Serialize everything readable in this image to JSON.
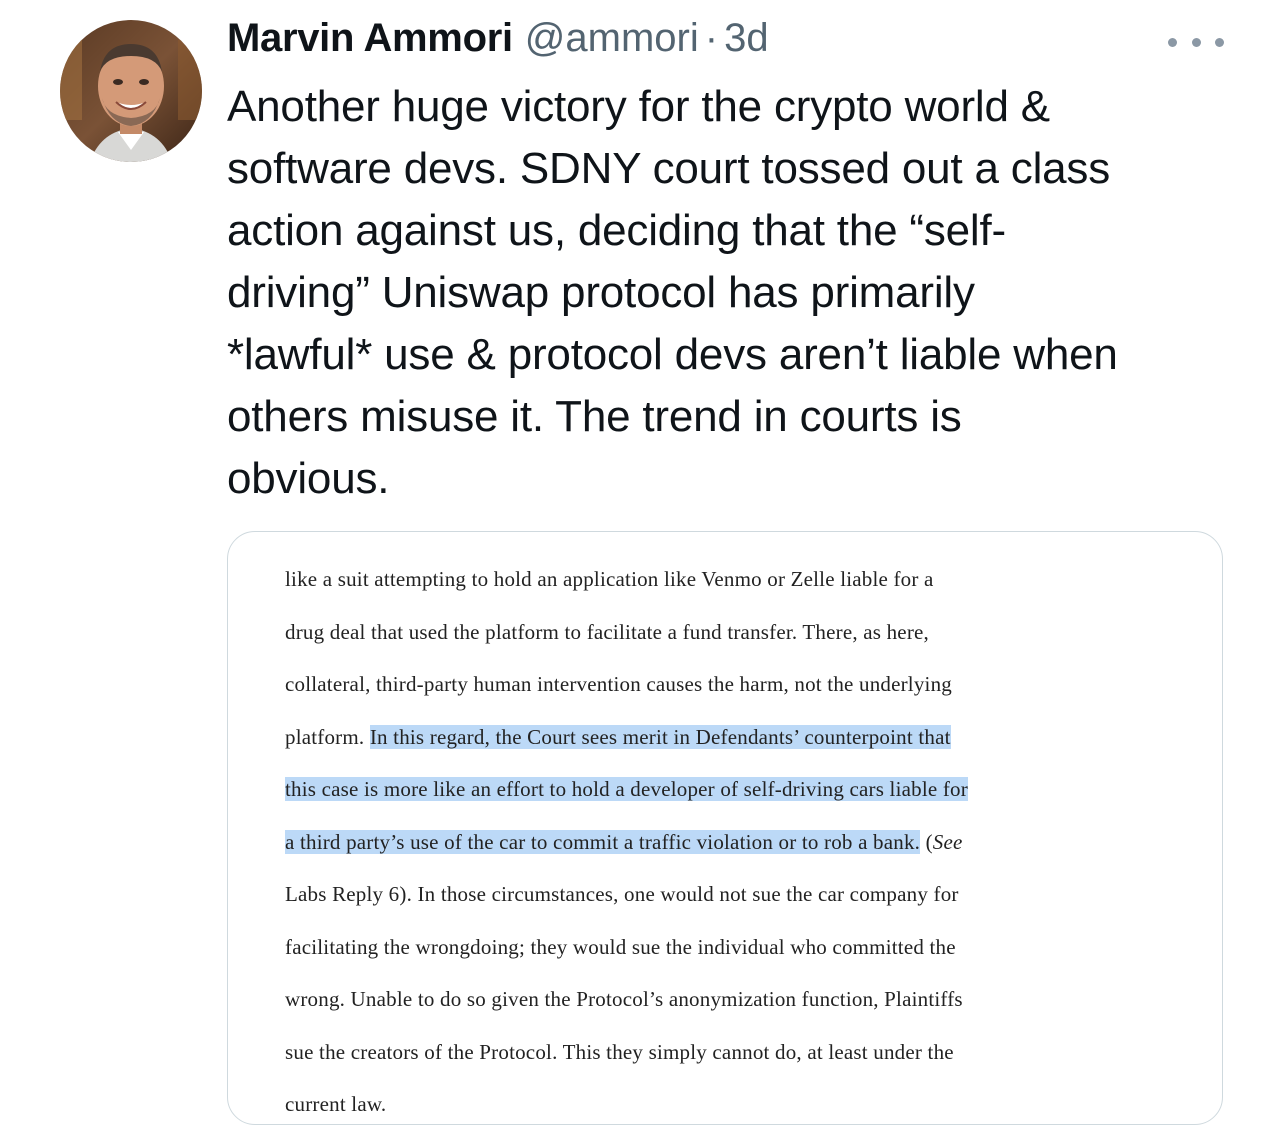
{
  "tweet": {
    "author": {
      "display_name": "Marvin Ammori",
      "handle": "@ammori",
      "separator": "·",
      "timestamp": "3d"
    },
    "more_icon": "more-horizontal-icon",
    "text": "Another huge victory for the crypto world &\nsoftware devs. SDNY court tossed out a class\naction against us, deciding that the “self-\ndriving” Uniswap protocol has primarily\n*lawful* use & protocol devs aren’t liable when\nothers misuse it. The trend in courts is\nobvious.",
    "media": {
      "lines": [
        {
          "segments": [
            {
              "text": "like a suit attempting to hold an application like Venmo or Zelle liable for a",
              "highlight": false
            }
          ]
        },
        {
          "segments": [
            {
              "text": "drug deal that used the platform to facilitate a fund transfer.  There, as here,",
              "highlight": false
            }
          ]
        },
        {
          "segments": [
            {
              "text": "collateral, third-party human intervention causes the harm, not the underlying",
              "highlight": false
            }
          ]
        },
        {
          "segments": [
            {
              "text": "platform.  ",
              "highlight": false
            },
            {
              "text": "In this regard, the Court sees merit in Defendants’ counterpoint that",
              "highlight": true
            }
          ]
        },
        {
          "segments": [
            {
              "text": "this case is more like an effort to hold a developer of self-driving cars liable for",
              "highlight": true
            }
          ]
        },
        {
          "segments": [
            {
              "text": "a third party’s use of the car to commit a traffic violation or to rob a bank.",
              "highlight": true
            },
            {
              "text": "  (",
              "highlight": false
            },
            {
              "text": "See",
              "highlight": false,
              "italic": true
            }
          ]
        },
        {
          "segments": [
            {
              "text": "Labs Reply 6).  In those circumstances, one would not sue the car company for",
              "highlight": false
            }
          ]
        },
        {
          "segments": [
            {
              "text": "facilitating the wrongdoing; they would sue the individual who committed the",
              "highlight": false
            }
          ]
        },
        {
          "segments": [
            {
              "text": "wrong.  Unable to do so given the Protocol’s anonymization function, Plaintiffs",
              "highlight": false
            }
          ]
        },
        {
          "segments": [
            {
              "text": "sue the creators of the Protocol.  This they simply cannot do, at least under the",
              "highlight": false
            }
          ]
        },
        {
          "segments": [
            {
              "text": "current law.",
              "highlight": false
            }
          ]
        }
      ]
    }
  }
}
